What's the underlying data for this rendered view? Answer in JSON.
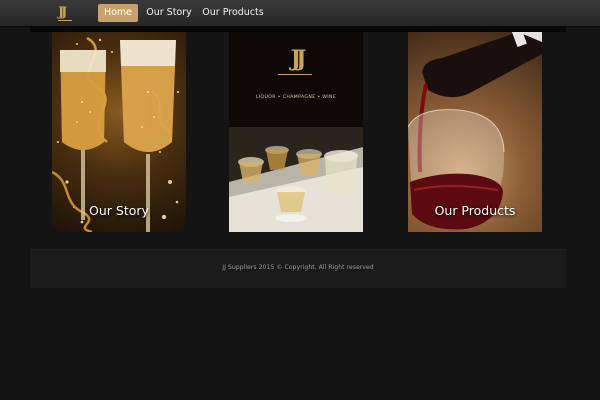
{
  "brand": {
    "logo_text": "JJ"
  },
  "nav": {
    "items": [
      {
        "label": "Home",
        "active": true
      },
      {
        "label": "Our Story",
        "active": false
      },
      {
        "label": "Our Products",
        "active": false
      }
    ]
  },
  "tiles": {
    "story": {
      "label": "Our Story",
      "image": "champagne-glasses-image"
    },
    "brand": {
      "logo_text": "JJ",
      "tagline": "LIQUOR • CHAMPAGNE • WINE",
      "image": "whisky-tasting-glasses-image"
    },
    "products": {
      "label": "Our Products",
      "image": "red-wine-pour-image"
    }
  },
  "footer": {
    "text": "JJ Suppliers 2015 © Copyright. All Right reserved"
  },
  "colors": {
    "accent": "#c9a26b",
    "gold": "#c8a35c",
    "background": "#141414",
    "nav_bg": "#2f2f2f"
  }
}
